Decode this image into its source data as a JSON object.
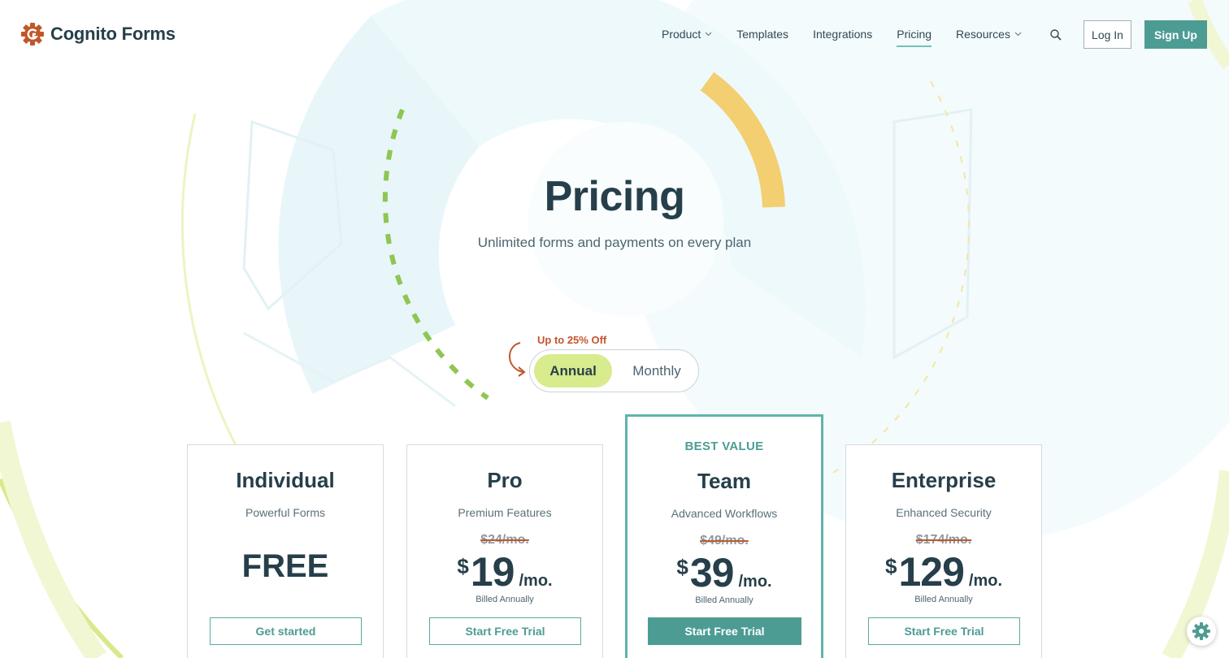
{
  "brand": {
    "name": "Cognito Forms",
    "accent": "#4d9c94",
    "orange": "#c2562b",
    "lime": "#d8eb8d",
    "yellow": "#f3cf72"
  },
  "nav": {
    "items": [
      {
        "label": "Product",
        "has_dropdown": true,
        "active": false
      },
      {
        "label": "Templates",
        "has_dropdown": false,
        "active": false
      },
      {
        "label": "Integrations",
        "has_dropdown": false,
        "active": false
      },
      {
        "label": "Pricing",
        "has_dropdown": false,
        "active": true
      },
      {
        "label": "Resources",
        "has_dropdown": true,
        "active": false
      }
    ],
    "search_icon": "search-icon",
    "login_label": "Log In",
    "signup_label": "Sign Up"
  },
  "hero": {
    "title": "Pricing",
    "subtitle": "Unlimited forms and payments on every plan"
  },
  "billing_toggle": {
    "discount_label": "Up to 25% Off",
    "options": [
      "Annual",
      "Monthly"
    ],
    "selected": "Annual"
  },
  "plans": [
    {
      "name": "Individual",
      "tagline": "Powerful Forms",
      "price_text": "FREE",
      "button": "Get started"
    },
    {
      "name": "Pro",
      "tagline": "Premium Features",
      "old_price": "$24/mo.",
      "currency": "$",
      "amount": "19",
      "period": "/mo.",
      "billing": "Billed Annually",
      "button": "Start Free Trial"
    },
    {
      "name": "Team",
      "badge": "BEST VALUE",
      "tagline": "Advanced Workflows",
      "old_price": "$49/mo.",
      "currency": "$",
      "amount": "39",
      "period": "/mo.",
      "billing": "Billed Annually",
      "button": "Start Free Trial"
    },
    {
      "name": "Enterprise",
      "tagline": "Enhanced Security",
      "old_price": "$174/mo.",
      "currency": "$",
      "amount": "129",
      "period": "/mo.",
      "billing": "Billed Annually",
      "button": "Start Free Trial"
    }
  ],
  "widget_icon": "gear-icon"
}
